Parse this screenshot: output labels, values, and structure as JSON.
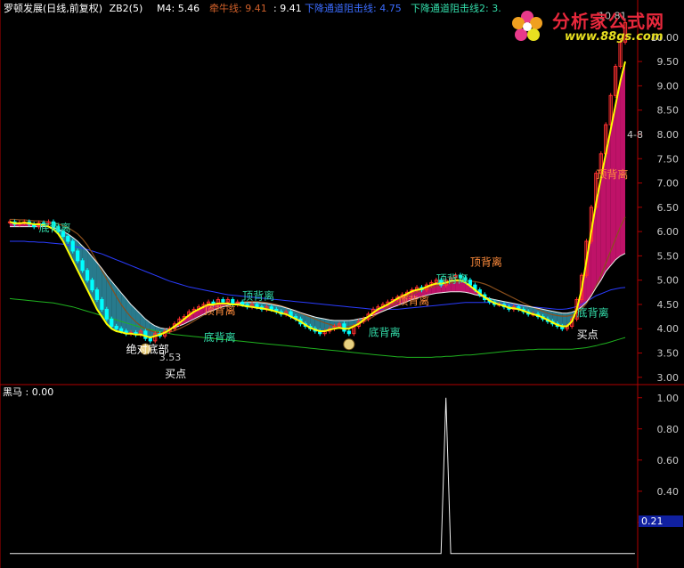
{
  "header": {
    "title": "罗顿发展(日线,前复权)",
    "formula": "ZB2(5)",
    "m4_label": "M4: 5.46",
    "qianniu_label": "牵牛线: 9.41",
    "qianniu_value": ": 9.41",
    "down_channel_1": "下降通道阻击线: 4.75",
    "down_channel_2": "下降通道阻击线2: 3."
  },
  "logo": {
    "brand": "分析家公式网",
    "url": "www.88gs.com"
  },
  "colors": {
    "background": "#000000",
    "axis": "#b00000",
    "tick_text": "#c8c8c8",
    "up_candle": "#ff3030",
    "down_candle": "#00ffff",
    "white_line": "#f0f0f0",
    "yellow_line": "#ffff00",
    "blue_line": "#2a3cff",
    "green_line": "#1fb21f",
    "brown_line": "#8a4f1c",
    "teal_band": "#2f8fa5",
    "magenta_band": "#e0157a",
    "label_green": "#33ddaa",
    "label_orange": "#ff8c3c",
    "qianniu_color": "#d0602a",
    "down_channel_1_color": "#3b6cff",
    "down_channel_2_color": "#33ddaa"
  },
  "chart_data": [
    {
      "type": "line",
      "title": "罗顿发展(日线,前复权)",
      "y_ticks": [
        "10.00",
        "9.50",
        "9.00",
        "8.50",
        "8.00",
        "7.50",
        "7.00",
        "6.50",
        "6.00",
        "5.50",
        "5.00",
        "4.50",
        "4.00",
        "3.50",
        "3.00"
      ],
      "ylim": [
        2.85,
        10.4
      ],
      "grid": false,
      "annotations": {
        "high_price": "10.81",
        "low_price": "3.53",
        "right_marker": "4-8",
        "labels": [
          {
            "text": "底背离",
            "x": 6,
            "y": 6.0,
            "color_key": "label_green"
          },
          {
            "text": "绝对底部",
            "x": 24,
            "y": 3.5,
            "color_key": "white"
          },
          {
            "text": "买点",
            "x": 32,
            "y": 3.0,
            "color_key": "white"
          },
          {
            "text": "底背离",
            "x": 40,
            "y": 3.75,
            "color_key": "label_green"
          },
          {
            "text": "顶背离",
            "x": 40,
            "y": 4.3,
            "color_key": "label_orange"
          },
          {
            "text": "顶背离",
            "x": 48,
            "y": 4.6,
            "color_key": "label_green"
          },
          {
            "text": "底背离",
            "x": 74,
            "y": 3.85,
            "color_key": "label_green"
          },
          {
            "text": "顶背离",
            "x": 80,
            "y": 4.5,
            "color_key": "label_orange"
          },
          {
            "text": "顶背离",
            "x": 88,
            "y": 4.95,
            "color_key": "label_green"
          },
          {
            "text": "顶背离",
            "x": 95,
            "y": 5.3,
            "color_key": "label_orange"
          },
          {
            "text": "底背离",
            "x": 117,
            "y": 4.25,
            "color_key": "label_green"
          },
          {
            "text": "买点",
            "x": 117,
            "y": 3.8,
            "color_key": "white"
          },
          {
            "text": "顶背离",
            "x": 121,
            "y": 7.1,
            "color_key": "label_orange"
          }
        ],
        "coin_markers": [
          28,
          70
        ]
      },
      "series": [
        {
          "kind": "close",
          "color_key": "up_candle",
          "values": [
            6.2,
            6.15,
            6.18,
            6.2,
            6.15,
            6.1,
            6.18,
            6.15,
            6.2,
            6.1,
            6.0,
            5.9,
            5.8,
            5.6,
            5.4,
            5.2,
            5.0,
            4.8,
            4.6,
            4.4,
            4.2,
            4.05,
            4.0,
            3.95,
            3.9,
            3.92,
            3.88,
            3.95,
            3.8,
            3.75,
            3.9,
            3.85,
            3.95,
            4.0,
            4.1,
            4.2,
            4.25,
            4.35,
            4.4,
            4.45,
            4.5,
            4.55,
            4.5,
            4.6,
            4.55,
            4.6,
            4.5,
            4.55,
            4.5,
            4.45,
            4.5,
            4.45,
            4.4,
            4.45,
            4.4,
            4.35,
            4.3,
            4.35,
            4.25,
            4.2,
            4.1,
            4.05,
            4.0,
            3.95,
            3.9,
            3.95,
            4.0,
            4.05,
            4.1,
            3.95,
            3.9,
            4.05,
            4.15,
            4.2,
            4.3,
            4.4,
            4.45,
            4.5,
            4.55,
            4.6,
            4.65,
            4.7,
            4.75,
            4.8,
            4.85,
            4.8,
            4.9,
            4.95,
            5.0,
            4.9,
            5.0,
            5.05,
            5.1,
            5.05,
            5.0,
            4.9,
            4.8,
            4.7,
            4.6,
            4.55,
            4.5,
            4.5,
            4.45,
            4.4,
            4.45,
            4.4,
            4.35,
            4.3,
            4.3,
            4.25,
            4.2,
            4.15,
            4.1,
            4.05,
            4.0,
            4.05,
            4.2,
            4.6,
            5.1,
            5.8,
            6.5,
            7.2,
            7.6,
            8.2,
            8.8,
            9.4,
            9.9,
            10.3
          ]
        },
        {
          "kind": "ma_yellow",
          "color_key": "yellow_line",
          "values": [
            6.2,
            6.17,
            6.17,
            6.18,
            6.17,
            6.15,
            6.15,
            6.13,
            6.1,
            6.05,
            5.95,
            5.8,
            5.6,
            5.4,
            5.2,
            5.0,
            4.8,
            4.6,
            4.4,
            4.25,
            4.1,
            4.0,
            3.95,
            3.93,
            3.9,
            3.9,
            3.88,
            3.88,
            3.85,
            3.82,
            3.85,
            3.88,
            3.92,
            3.98,
            4.05,
            4.12,
            4.2,
            4.28,
            4.35,
            4.4,
            4.45,
            4.5,
            4.5,
            4.52,
            4.52,
            4.52,
            4.5,
            4.5,
            4.48,
            4.46,
            4.45,
            4.43,
            4.42,
            4.4,
            4.38,
            4.35,
            4.32,
            4.3,
            4.25,
            4.2,
            4.15,
            4.08,
            4.02,
            3.98,
            3.95,
            3.95,
            3.98,
            4.0,
            4.02,
            4.0,
            4.0,
            4.05,
            4.1,
            4.18,
            4.25,
            4.33,
            4.4,
            4.45,
            4.5,
            4.56,
            4.62,
            4.67,
            4.72,
            4.77,
            4.8,
            4.82,
            4.86,
            4.9,
            4.93,
            4.93,
            4.95,
            4.98,
            5.0,
            5.0,
            4.95,
            4.88,
            4.8,
            4.72,
            4.65,
            4.58,
            4.53,
            4.5,
            4.47,
            4.43,
            4.42,
            4.4,
            4.37,
            4.33,
            4.3,
            4.27,
            4.23,
            4.18,
            4.13,
            4.08,
            4.05,
            4.05,
            4.15,
            4.4,
            4.8,
            5.4,
            6.0,
            6.6,
            7.1,
            7.6,
            8.1,
            8.6,
            9.1,
            9.5
          ]
        },
        {
          "kind": "ma_white",
          "color_key": "white_line",
          "values": [
            6.1,
            6.1,
            6.1,
            6.1,
            6.1,
            6.1,
            6.1,
            6.1,
            6.1,
            6.08,
            6.05,
            6.0,
            5.95,
            5.88,
            5.8,
            5.7,
            5.6,
            5.48,
            5.36,
            5.24,
            5.1,
            4.98,
            4.86,
            4.74,
            4.62,
            4.5,
            4.4,
            4.3,
            4.2,
            4.12,
            4.06,
            4.02,
            4.0,
            4.0,
            4.02,
            4.06,
            4.1,
            4.15,
            4.2,
            4.25,
            4.3,
            4.35,
            4.38,
            4.42,
            4.45,
            4.48,
            4.5,
            4.52,
            4.53,
            4.54,
            4.54,
            4.54,
            4.53,
            4.52,
            4.5,
            4.48,
            4.46,
            4.43,
            4.4,
            4.37,
            4.33,
            4.3,
            4.27,
            4.24,
            4.22,
            4.2,
            4.18,
            4.17,
            4.17,
            4.17,
            4.17,
            4.18,
            4.2,
            4.22,
            4.25,
            4.28,
            4.32,
            4.36,
            4.4,
            4.44,
            4.48,
            4.52,
            4.56,
            4.6,
            4.63,
            4.66,
            4.69,
            4.71,
            4.73,
            4.74,
            4.75,
            4.76,
            4.76,
            4.76,
            4.75,
            4.73,
            4.7,
            4.68,
            4.65,
            4.62,
            4.6,
            4.58,
            4.56,
            4.54,
            4.52,
            4.5,
            4.48,
            4.46,
            4.44,
            4.42,
            4.4,
            4.38,
            4.36,
            4.34,
            4.32,
            4.32,
            4.34,
            4.38,
            4.45,
            4.55,
            4.68,
            4.85,
            5.0,
            5.18,
            5.3,
            5.42,
            5.5,
            5.55
          ]
        },
        {
          "kind": "ma_blue",
          "color_key": "blue_line",
          "values": [
            5.8,
            5.8,
            5.8,
            5.8,
            5.79,
            5.79,
            5.78,
            5.78,
            5.77,
            5.76,
            5.75,
            5.74,
            5.72,
            5.7,
            5.68,
            5.66,
            5.63,
            5.6,
            5.57,
            5.54,
            5.5,
            5.46,
            5.42,
            5.38,
            5.34,
            5.3,
            5.26,
            5.22,
            5.18,
            5.14,
            5.1,
            5.06,
            5.02,
            4.98,
            4.95,
            4.92,
            4.89,
            4.86,
            4.84,
            4.82,
            4.8,
            4.78,
            4.76,
            4.74,
            4.72,
            4.7,
            4.69,
            4.68,
            4.67,
            4.66,
            4.65,
            4.64,
            4.63,
            4.62,
            4.61,
            4.6,
            4.59,
            4.58,
            4.57,
            4.56,
            4.55,
            4.54,
            4.53,
            4.52,
            4.51,
            4.5,
            4.49,
            4.48,
            4.47,
            4.46,
            4.45,
            4.44,
            4.43,
            4.42,
            4.41,
            4.4,
            4.4,
            4.4,
            4.4,
            4.4,
            4.4,
            4.41,
            4.42,
            4.43,
            4.44,
            4.45,
            4.46,
            4.47,
            4.48,
            4.49,
            4.5,
            4.51,
            4.52,
            4.53,
            4.54,
            4.54,
            4.54,
            4.54,
            4.54,
            4.54,
            4.53,
            4.52,
            4.51,
            4.5,
            4.49,
            4.48,
            4.47,
            4.46,
            4.45,
            4.44,
            4.43,
            4.42,
            4.41,
            4.4,
            4.4,
            4.41,
            4.43,
            4.46,
            4.5,
            4.56,
            4.62,
            4.68,
            4.72,
            4.76,
            4.8,
            4.82,
            4.84,
            4.85
          ]
        },
        {
          "kind": "ma_green",
          "color_key": "green_line",
          "values": [
            4.62,
            4.61,
            4.6,
            4.59,
            4.58,
            4.57,
            4.56,
            4.55,
            4.54,
            4.53,
            4.51,
            4.49,
            4.47,
            4.45,
            4.42,
            4.39,
            4.36,
            4.33,
            4.3,
            4.27,
            4.24,
            4.21,
            4.18,
            4.15,
            4.12,
            4.09,
            4.06,
            4.03,
            4.0,
            3.98,
            3.96,
            3.94,
            3.92,
            3.9,
            3.88,
            3.87,
            3.86,
            3.85,
            3.84,
            3.83,
            3.82,
            3.81,
            3.8,
            3.79,
            3.78,
            3.77,
            3.76,
            3.75,
            3.74,
            3.73,
            3.72,
            3.71,
            3.7,
            3.69,
            3.68,
            3.67,
            3.66,
            3.65,
            3.64,
            3.63,
            3.62,
            3.61,
            3.6,
            3.59,
            3.58,
            3.57,
            3.56,
            3.55,
            3.54,
            3.53,
            3.52,
            3.51,
            3.5,
            3.49,
            3.48,
            3.47,
            3.46,
            3.45,
            3.44,
            3.43,
            3.42,
            3.42,
            3.41,
            3.41,
            3.41,
            3.41,
            3.41,
            3.41,
            3.42,
            3.42,
            3.43,
            3.43,
            3.44,
            3.45,
            3.46,
            3.46,
            3.47,
            3.48,
            3.49,
            3.5,
            3.51,
            3.52,
            3.53,
            3.54,
            3.55,
            3.56,
            3.56,
            3.57,
            3.57,
            3.58,
            3.58,
            3.58,
            3.58,
            3.58,
            3.58,
            3.58,
            3.58,
            3.59,
            3.6,
            3.61,
            3.63,
            3.65,
            3.68,
            3.7,
            3.73,
            3.76,
            3.79,
            3.82
          ]
        },
        {
          "kind": "ma_brown",
          "color_key": "brown_line",
          "values": [
            6.25,
            6.25,
            6.24,
            6.24,
            6.23,
            6.22,
            6.22,
            6.21,
            6.2,
            6.18,
            6.16,
            6.12,
            6.08,
            6.02,
            5.95,
            5.85,
            5.72,
            5.56,
            5.38,
            5.2,
            5.02,
            4.84,
            4.66,
            4.5,
            4.36,
            4.24,
            4.14,
            4.06,
            4.0,
            3.96,
            3.93,
            3.92,
            3.92,
            3.93,
            3.96,
            4.0,
            4.05,
            4.1,
            4.16,
            4.22,
            4.28,
            4.33,
            4.38,
            4.42,
            4.46,
            4.49,
            4.52,
            4.54,
            4.55,
            4.56,
            4.56,
            4.56,
            4.55,
            4.54,
            4.52,
            4.5,
            4.47,
            4.44,
            4.4,
            4.36,
            4.32,
            4.28,
            4.24,
            4.2,
            4.16,
            4.12,
            4.09,
            4.06,
            4.05,
            4.04,
            4.05,
            4.07,
            4.1,
            4.14,
            4.19,
            4.25,
            4.31,
            4.37,
            4.43,
            4.49,
            4.55,
            4.61,
            4.66,
            4.71,
            4.75,
            4.79,
            4.82,
            4.85,
            4.88,
            4.9,
            4.92,
            4.94,
            4.96,
            4.97,
            4.98,
            4.98,
            4.97,
            4.95,
            4.92,
            4.88,
            4.83,
            4.78,
            4.73,
            4.68,
            4.63,
            4.58,
            4.53,
            4.48,
            4.44,
            4.4,
            4.36,
            4.32,
            4.29,
            4.27,
            4.26,
            4.26,
            4.28,
            4.32,
            4.4,
            4.52,
            4.68,
            4.88,
            5.1,
            5.35,
            5.6,
            5.85,
            6.1,
            6.3
          ]
        }
      ]
    },
    {
      "type": "line",
      "title": "黑马",
      "value_label": "黑马 : 0.00",
      "y_ticks": [
        "1.00",
        "0.80",
        "0.60",
        "0.40",
        "0.20"
      ],
      "ylim": [
        -0.07,
        1.05
      ],
      "current_value_badge": "0.21",
      "series": [
        {
          "name": "黑马",
          "color_key": "white_line",
          "values": [
            0,
            0,
            0,
            0,
            0,
            0,
            0,
            0,
            0,
            0,
            0,
            0,
            0,
            0,
            0,
            0,
            0,
            0,
            0,
            0,
            0,
            0,
            0,
            0,
            0,
            0,
            0,
            0,
            0,
            0,
            0,
            0,
            0,
            0,
            0,
            0,
            0,
            0,
            0,
            0,
            0,
            0,
            0,
            0,
            0,
            0,
            0,
            0,
            0,
            0,
            0,
            0,
            0,
            0,
            0,
            0,
            0,
            0,
            0,
            0,
            0,
            0,
            0,
            0,
            0,
            0,
            0,
            0,
            0,
            0,
            0,
            0,
            0,
            0,
            0,
            0,
            0,
            0,
            0,
            0,
            0,
            0,
            0,
            0,
            0,
            0,
            0,
            0,
            0,
            0,
            1,
            0,
            0,
            0,
            0,
            0,
            0,
            0,
            0,
            0,
            0,
            0,
            0,
            0,
            0,
            0,
            0,
            0,
            0,
            0,
            0,
            0,
            0,
            0,
            0,
            0,
            0,
            0,
            0,
            0,
            0,
            0,
            0,
            0,
            0,
            0,
            0,
            0,
            0,
            0
          ]
        }
      ]
    }
  ]
}
